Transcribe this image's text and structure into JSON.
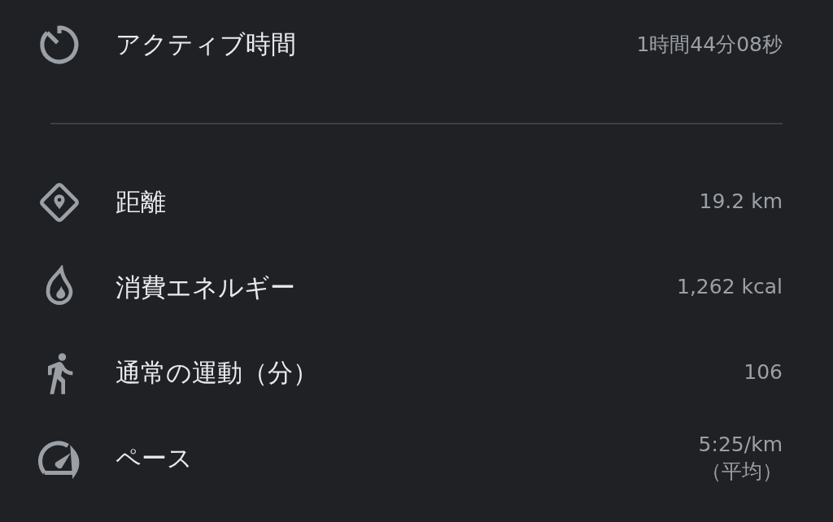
{
  "summary": {
    "label": "アクティブ時間",
    "value_lines": [
      "1時間44分08秒"
    ]
  },
  "metrics": [
    {
      "label": "距離",
      "value_lines": [
        "19.2 km"
      ]
    },
    {
      "label": "消費エネルギー",
      "value_lines": [
        "1,262 kcal"
      ]
    },
    {
      "label": "通常の運動（分）",
      "value_lines": [
        "106"
      ]
    },
    {
      "label": "ペース",
      "value_lines": [
        "5:25/km",
        "（平均）"
      ]
    }
  ]
}
